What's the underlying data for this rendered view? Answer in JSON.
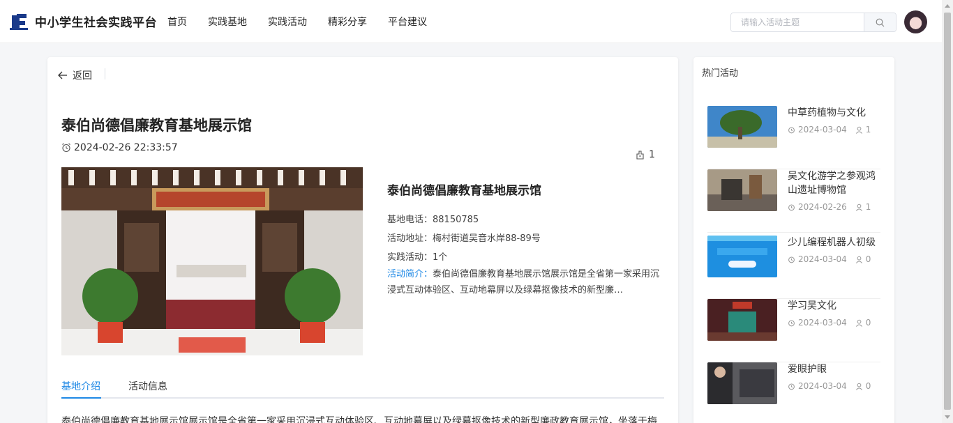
{
  "header": {
    "site_title": "中小学生社会实践平台",
    "nav": [
      "首页",
      "实践基地",
      "实践活动",
      "精彩分享",
      "平台建议"
    ],
    "search_placeholder": "请输入活动主题"
  },
  "detail": {
    "back_label": "返回",
    "title": "泰伯尚德倡廉教育基地展示馆",
    "datetime": "2024-02-26 22:33:57",
    "like_count": "1",
    "info_title": "泰伯尚德倡廉教育基地展示馆",
    "phone_label": "基地电话：",
    "phone": "88150785",
    "address_label": "活动地址：",
    "address": "梅村街道吴音水岸88-89号",
    "activities_label": "实践活动：",
    "activities": "1个",
    "desc_label": "活动简介：",
    "desc": "泰伯尚德倡廉教育基地展示馆展示馆是全省第一家采用沉浸式互动体验区、互动地幕屏以及绿幕抠像技术的新型廉…",
    "tabs": [
      "基地介绍",
      "活动信息"
    ],
    "body": "泰伯尚德倡廉教育基地展示馆展示馆是全省第一家采用沉浸式互动体验区、互动地幕屏以及绿幕抠像技术的新型廉政教育展示馆，坐落于梅"
  },
  "sidebar": {
    "title": "热门活动",
    "items": [
      {
        "name": "中草药植物与文化",
        "date": "2024-03-04",
        "count": "1"
      },
      {
        "name": "吴文化游学之参观鸿山遗址博物馆",
        "date": "2024-02-26",
        "count": "1"
      },
      {
        "name": "少儿编程机器人初级",
        "date": "2024-03-04",
        "count": "0"
      },
      {
        "name": "学习吴文化",
        "date": "2024-03-04",
        "count": "0"
      },
      {
        "name": "爱眼护眼",
        "date": "2024-03-04",
        "count": "0"
      }
    ]
  },
  "colors": {
    "accent": "#1e88e5",
    "logo": "#1a3a8a"
  }
}
